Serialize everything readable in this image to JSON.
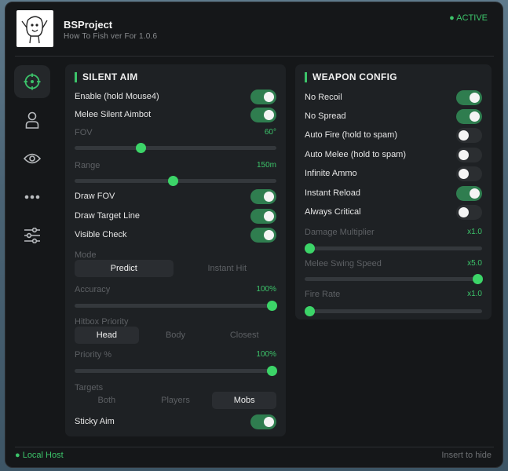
{
  "header": {
    "title": "BSProject",
    "subtitle": "How To Fish ver For 1.0.6",
    "status": "● ACTIVE"
  },
  "footer": {
    "left": "● Local Host",
    "right": "Insert to hide"
  },
  "nav": [
    "crosshair-icon",
    "user-icon",
    "eye-icon",
    "more-icon",
    "sliders-icon"
  ],
  "silent_aim": {
    "title": "SILENT AIM",
    "enable": {
      "label": "Enable (hold Mouse4)",
      "on": true
    },
    "melee": {
      "label": "Melee Silent Aimbot",
      "on": true
    },
    "fov": {
      "label": "FOV",
      "value": "60°",
      "level": 0.32
    },
    "range": {
      "label": "Range",
      "value": "150m",
      "level": 0.485
    },
    "draw_fov": {
      "label": "Draw FOV",
      "on": true
    },
    "draw_target": {
      "label": "Draw Target Line",
      "on": true
    },
    "visible_check": {
      "label": "Visible Check",
      "on": true
    },
    "mode": {
      "label": "Mode",
      "options": [
        "Predict",
        "Instant Hit"
      ],
      "selected": "Predict"
    },
    "accuracy": {
      "label": "Accuracy",
      "value": "100%",
      "level": 1.0
    },
    "hitbox": {
      "label": "Hitbox Priority",
      "options": [
        "Head",
        "Body",
        "Closest"
      ],
      "selected": "Head"
    },
    "priority": {
      "label": "Priority %",
      "value": "100%",
      "level": 1.0
    },
    "targets": {
      "label": "Targets",
      "options": [
        "Both",
        "Players",
        "Mobs"
      ],
      "selected": "Mobs"
    },
    "sticky": {
      "label": "Sticky Aim",
      "on": true
    }
  },
  "weapon_config": {
    "title": "WEAPON CONFIG",
    "no_recoil": {
      "label": "No Recoil",
      "on": true
    },
    "no_spread": {
      "label": "No Spread",
      "on": true
    },
    "auto_fire": {
      "label": "Auto Fire (hold to spam)",
      "on": false
    },
    "auto_melee": {
      "label": "Auto Melee (hold to spam)",
      "on": false
    },
    "infinite_ammo": {
      "label": "Infinite Ammo",
      "on": false
    },
    "instant_reload": {
      "label": "Instant Reload",
      "on": true
    },
    "always_critical": {
      "label": "Always Critical",
      "on": false
    },
    "damage_mult": {
      "label": "Damage Multiplier",
      "value": "x1.0",
      "level": 0.0
    },
    "melee_speed": {
      "label": "Melee Swing Speed",
      "value": "x5.0",
      "level": 1.0
    },
    "fire_rate": {
      "label": "Fire Rate",
      "value": "x1.0",
      "level": 0.0
    }
  },
  "colors": {
    "accent": "#3cc46a",
    "toggle_on": "#2f7d4f",
    "panel": "#1e2124",
    "window": "#151719"
  }
}
